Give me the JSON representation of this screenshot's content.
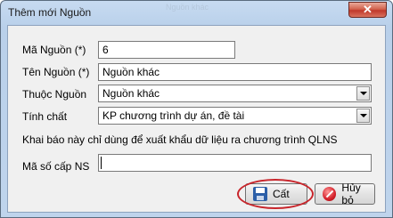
{
  "window": {
    "title": "Thêm mới Nguồn",
    "background_title": "Nguồn khác",
    "close_label": "✕"
  },
  "form": {
    "ma_nguon": {
      "label": "Mã Nguồn (*)",
      "value": "6"
    },
    "ten_nguon": {
      "label": "Tên Nguồn (*)",
      "value": "Nguồn khác"
    },
    "thuoc_nguon": {
      "label": "Thuộc Nguồn",
      "value": "Nguồn khác"
    },
    "tinh_chat": {
      "label": "Tính chất",
      "value": "KP chương trình dự án, đề tài"
    },
    "note": "Khai báo này chỉ dùng để xuất khẩu dữ liệu ra chương trình QLNS",
    "ma_so_cap_ns": {
      "label": "Mã số cấp NS",
      "value": ""
    }
  },
  "buttons": {
    "save_label": "Cất",
    "cancel_label": "Hủy bỏ"
  },
  "colors": {
    "highlight": "#c8252b",
    "close_button": "#c0392b",
    "window_frame": "#b9d0ea"
  },
  "icons": {
    "save": "floppy-disk-icon",
    "cancel": "no-entry-icon"
  }
}
